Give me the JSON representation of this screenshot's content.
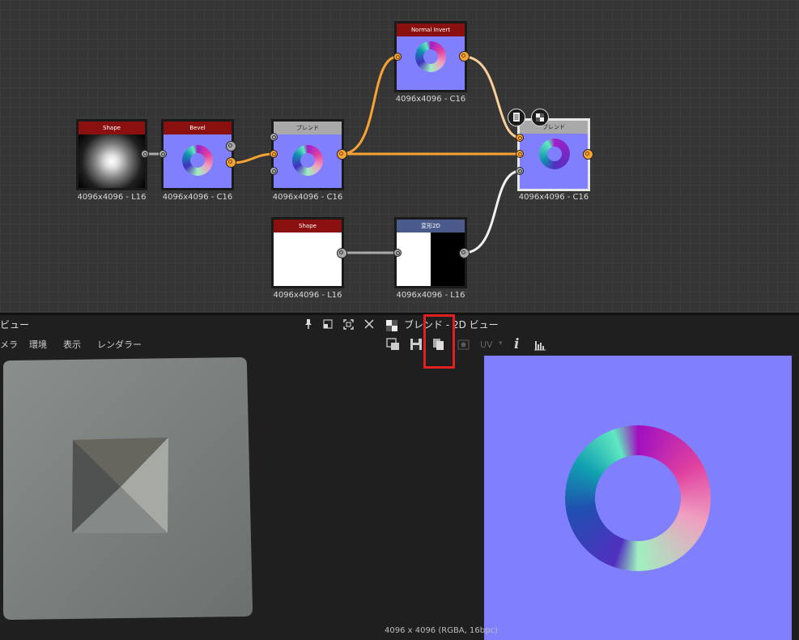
{
  "graph": {
    "nodes": {
      "shape1": {
        "title": "Shape",
        "label": "4096x4096 - L16"
      },
      "bevel": {
        "title": "Bevel",
        "label": "4096x4096 - C16"
      },
      "blend1": {
        "title": "ブレンド",
        "label": "4096x4096 - C16"
      },
      "normal_invert": {
        "title": "Normal Invert",
        "label": "4096x4096 - C16"
      },
      "blend2": {
        "title": "ブレンド",
        "label": "4096x4096 - C16"
      },
      "shape2": {
        "title": "Shape",
        "label": "4096x4096 - L16"
      },
      "transform2d": {
        "title": "変形2D",
        "label": "4096x4096 - L16"
      }
    }
  },
  "left_panel": {
    "title": "ビュー",
    "menu": [
      "メラ",
      "環境",
      "表示",
      "レンダラー"
    ]
  },
  "right_panel": {
    "title": "ブレンド - 2D ビュー",
    "uv_label": "UV",
    "info_icon": "i",
    "status": "4096 x 4096 (RGBA, 16bpc)"
  },
  "colors": {
    "normal_bg": "#8080ff",
    "header_red": "#8b1010",
    "header_gray": "#a9a9a9",
    "header_blue": "#4a5a8a",
    "wire_orange": "#f6a334",
    "highlight": "#e02020"
  }
}
